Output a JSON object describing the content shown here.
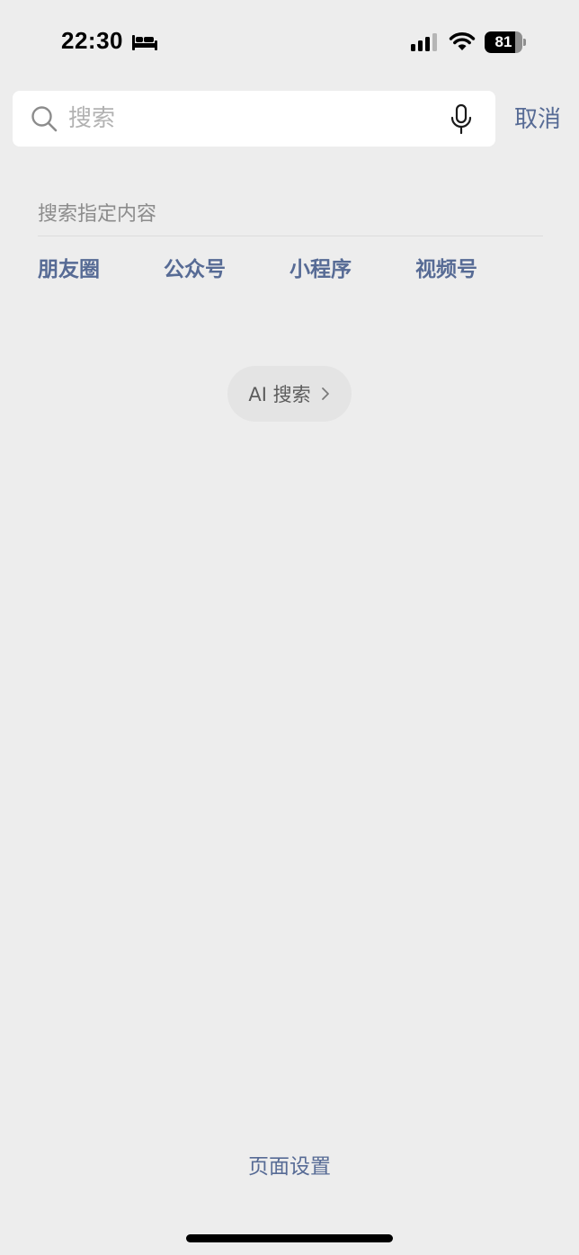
{
  "status_bar": {
    "time": "22:30",
    "battery_level": "81",
    "battery_fraction": 0.81
  },
  "search": {
    "value": "",
    "placeholder": "搜索",
    "cancel_label": "取消"
  },
  "section": {
    "title": "搜索指定内容",
    "categories": [
      {
        "label": "朋友圈"
      },
      {
        "label": "公众号"
      },
      {
        "label": "小程序"
      },
      {
        "label": "视频号"
      }
    ]
  },
  "ai_search": {
    "label": "AI 搜索"
  },
  "footer": {
    "page_settings_label": "页面设置"
  },
  "colors": {
    "accent": "#576b95",
    "background": "#ededed",
    "muted_text": "#8c8c8c"
  },
  "icons": [
    "sleep-icon",
    "cellular-signal-icon",
    "wifi-icon",
    "battery-icon",
    "search-icon",
    "microphone-icon",
    "chevron-right-icon"
  ]
}
